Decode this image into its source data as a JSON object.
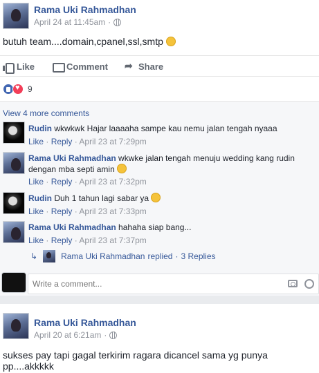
{
  "post1": {
    "author": "Rama Uki Rahmadhan",
    "timestamp": "April 24 at 11:45am",
    "text": "butuh team....domain,cpanel,ssl,smtp",
    "actions": {
      "like": "Like",
      "comment": "Comment",
      "share": "Share"
    },
    "reaction_count": "9",
    "view_more": "View 4 more comments",
    "comments": [
      {
        "author": "Rudin",
        "text": "wkwkwk Hajar laaaaha sampe kau nemu jalan tengah nyaaa",
        "like": "Like",
        "reply": "Reply",
        "time": "April 23 at 7:29pm"
      },
      {
        "author": "Rama Uki Rahmadhan",
        "text": "wkwke jalan tengah menuju wedding kang rudin",
        "text2": "dengan mba septi amin",
        "like": "Like",
        "reply": "Reply",
        "time": "April 23 at 7:32pm"
      },
      {
        "author": "Rudin",
        "text": "Duh 1 tahun lagi sabar ya",
        "like": "Like",
        "reply": "Reply",
        "time": "April 23 at 7:33pm"
      },
      {
        "author": "Rama Uki Rahmadhan",
        "text": "hahaha siap bang...",
        "like": "Like",
        "reply": "Reply",
        "time": "April 23 at 7:37pm"
      }
    ],
    "replies": {
      "author": "Rama Uki Rahmadhan",
      "text": "replied",
      "count": "3 Replies"
    },
    "write_placeholder": "Write a comment..."
  },
  "post2": {
    "author": "Rama Uki Rahmadhan",
    "timestamp": "April 20 at 6:21am",
    "text": "sukses pay tapi gagal terkirim ragara dicancel sama yg punya pp....akkkkk"
  },
  "separator": "·"
}
